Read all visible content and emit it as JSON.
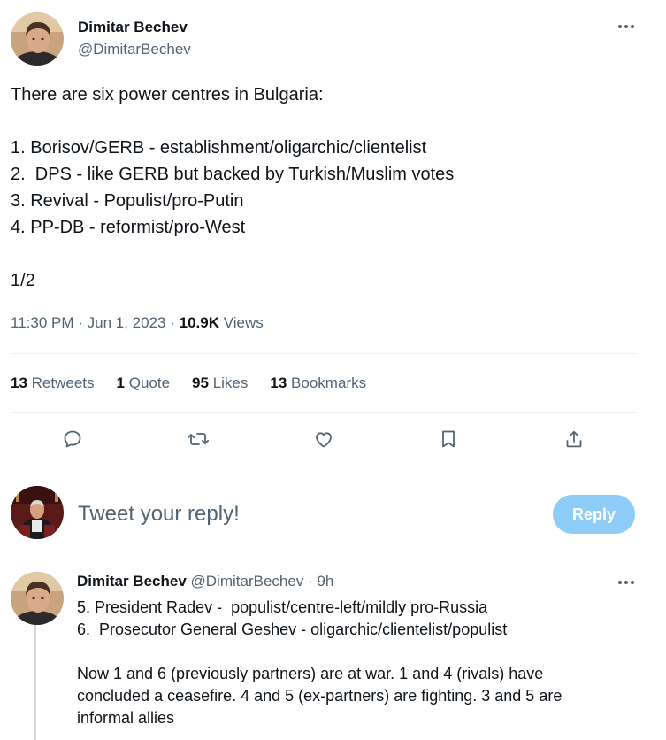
{
  "tweet": {
    "author": {
      "name": "Dimitar Bechev",
      "handle": "@DimitarBechev"
    },
    "text_lines": [
      "There are six power centres in Bulgaria:",
      "",
      "1. Borisov/GERB - establishment/oligarchic/clientelist",
      "2.  DPS - like GERB but backed by Turkish/Muslim votes",
      "3. Revival - Populist/pro-Putin",
      "4. PP-DB - reformist/pro-West",
      "",
      "1/2"
    ],
    "time": "11:30 PM",
    "date": "Jun 1, 2023",
    "views_count": "10.9K",
    "views_label": "Views",
    "stats": {
      "retweets": {
        "count": "13",
        "label": "Retweets"
      },
      "quotes": {
        "count": "1",
        "label": "Quote"
      },
      "likes": {
        "count": "95",
        "label": "Likes"
      },
      "bookmarks": {
        "count": "13",
        "label": "Bookmarks"
      }
    },
    "actions": [
      "reply-icon",
      "retweet-icon",
      "like-icon",
      "bookmark-icon",
      "share-icon"
    ]
  },
  "reply_composer": {
    "placeholder": "Tweet your reply!",
    "button_label": "Reply"
  },
  "reply_tweet": {
    "name": "Dimitar Bechev",
    "handle": "@DimitarBechev",
    "separator": "·",
    "age": "9h",
    "text_lines": [
      "5. President Radev -  populist/centre-left/mildly pro-Russia",
      "6.  Prosecutor General Geshev - oligarchic/clientelist/populist",
      "",
      "Now 1 and 6 (previously partners) are at war. 1 and 4 (rivals) have",
      "concluded a ceasefire. 4 and 5 (ex-partners) are fighting. 3 and 5 are",
      "informal allies"
    ]
  },
  "colors": {
    "text_primary": "#0f1419",
    "text_secondary": "#536471",
    "accent_disabled": "#8ecdf7",
    "divider": "#eff3f4",
    "thread_line": "#cfd9de"
  }
}
